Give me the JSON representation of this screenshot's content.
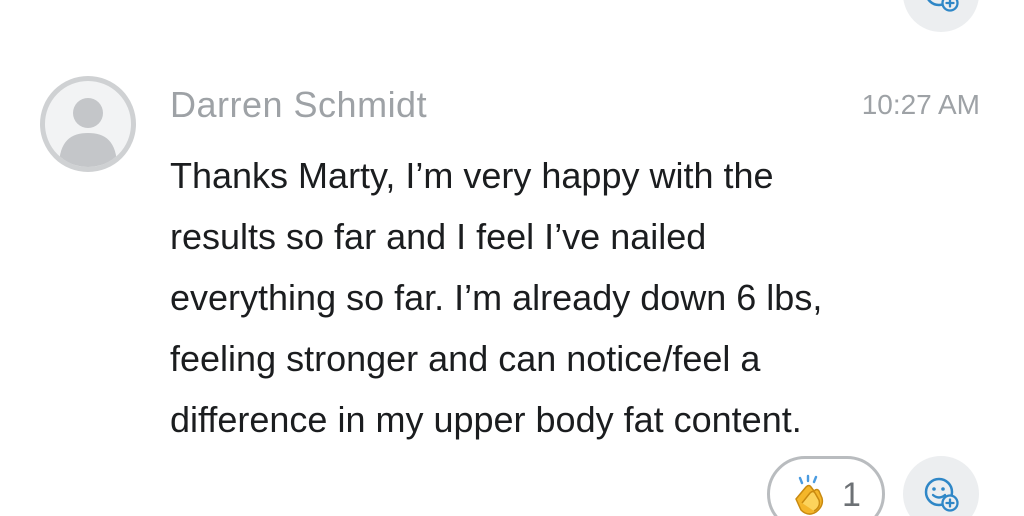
{
  "message": {
    "author": "Darren Schmidt",
    "timestamp": "10:27 AM",
    "lines": [
      "Thanks Marty, I’m very happy with the",
      "results so far and I feel I’ve nailed",
      "everything so far. I’m already down 6 lbs,",
      "feeling stronger and can notice/feel a",
      "difference in my upper body fat content."
    ],
    "avatar_icon": "default-user-avatar-icon"
  },
  "reactions": [
    {
      "icon": "clapping-hands-emoji-icon",
      "count": "1"
    }
  ],
  "add_reaction_icon": "add-reaction-smiley-icon",
  "colors": {
    "author_text": "#9ea2a6",
    "timestamp_text": "#9ea2a6",
    "message_text": "#1b1d1f",
    "reaction_border": "#b9bcbf",
    "add_reaction_bg": "#eceef0",
    "add_reaction_icon": "#2f87c7",
    "avatar_border": "#cfd1d3"
  }
}
